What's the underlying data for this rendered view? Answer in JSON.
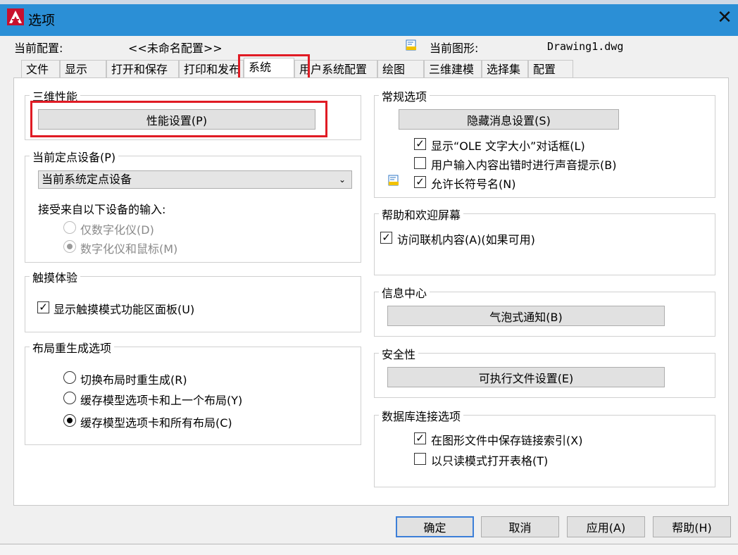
{
  "window": {
    "title": "选项",
    "close": "✕"
  },
  "header": {
    "profile_label": "当前配置:",
    "profile_value": "<<未命名配置>>",
    "drawing_label": "当前图形:",
    "drawing_value": "Drawing1.dwg"
  },
  "tabs": [
    {
      "label": "文件"
    },
    {
      "label": "显示"
    },
    {
      "label": "打开和保存"
    },
    {
      "label": "打印和发布"
    },
    {
      "label": "系统"
    },
    {
      "label": "用户系统配置"
    },
    {
      "label": "绘图"
    },
    {
      "label": "三维建模"
    },
    {
      "label": "选择集"
    },
    {
      "label": "配置"
    }
  ],
  "active_tab": "系统",
  "left": {
    "perf": {
      "title": "三维性能",
      "button": "性能设置(P)"
    },
    "pointing": {
      "title": "当前定点设备(P)",
      "selected": "当前系统定点设备",
      "accept_label": "接受来自以下设备的输入:",
      "radio1": "仅数字化仪(D)",
      "radio2": "数字化仪和鼠标(M)"
    },
    "touch": {
      "title": "触摸体验",
      "checkbox": "显示触摸模式功能区面板(U)"
    },
    "regen": {
      "title": "布局重生成选项",
      "opt1": "切换布局时重生成(R)",
      "opt2": "缓存模型选项卡和上一个布局(Y)",
      "opt3": "缓存模型选项卡和所有布局(C)"
    }
  },
  "right": {
    "general": {
      "title": "常规选项",
      "button": "隐藏消息设置(S)",
      "cb1": "显示“OLE 文字大小”对话框(L)",
      "cb2": "用户输入内容出错时进行声音提示(B)",
      "cb3": "允许长符号名(N)"
    },
    "help": {
      "title": "帮助和欢迎屏幕",
      "cb": "访问联机内容(A)(如果可用)"
    },
    "info": {
      "title": "信息中心",
      "button": "气泡式通知(B)"
    },
    "security": {
      "title": "安全性",
      "button": "可执行文件设置(E)"
    },
    "db": {
      "title": "数据库连接选项",
      "cb1": "在图形文件中保存链接索引(X)",
      "cb2": "以只读模式打开表格(T)"
    }
  },
  "checks": {
    "ole": "✓",
    "sound": "",
    "longnames": "✓",
    "online": "✓",
    "touch": "✓",
    "savelink": "✓",
    "readonly": ""
  },
  "buttons": {
    "ok": "确定",
    "cancel": "取消",
    "apply": "应用(A)",
    "help": "帮助(H)"
  },
  "colors": {
    "titlebar": "#2b8fd6",
    "highlight": "#e01b24",
    "default_button_border": "#3c7fd8"
  }
}
